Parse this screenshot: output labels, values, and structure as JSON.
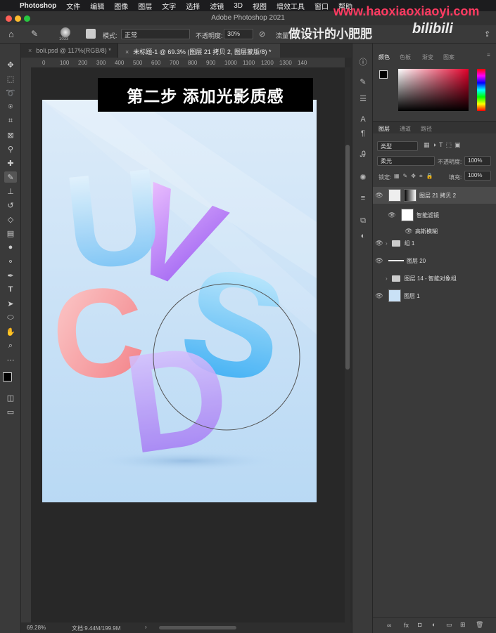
{
  "menubar": {
    "apple": "",
    "items": [
      "Photoshop",
      "文件",
      "编辑",
      "图像",
      "图层",
      "文字",
      "选择",
      "滤镜",
      "3D",
      "视图",
      "增效工具",
      "窗口",
      "帮助"
    ]
  },
  "window": {
    "title": "Adobe Photoshop 2021"
  },
  "options_bar": {
    "brush_size": "1033",
    "mode_label": "模式:",
    "mode_value": "正常",
    "opacity_label": "不透明度:",
    "opacity_value": "30%",
    "flow_label": "流量"
  },
  "doc_tabs": [
    {
      "label": "boli.psd @ 117%(RGB/8) *",
      "active": false
    },
    {
      "label": "未标题-1 @ 69.3% (图层 21 拷贝 2, 图层蒙版/8) *",
      "active": true
    }
  ],
  "ruler_top": [
    "0",
    "100",
    "200",
    "300",
    "400",
    "500",
    "600",
    "700",
    "800",
    "900",
    "1000",
    "1100",
    "1200",
    "1300",
    "140"
  ],
  "canvas": {
    "caption": "第二步 添加光影质感",
    "letters": [
      "U",
      "V",
      "C",
      "S",
      "D"
    ]
  },
  "status": {
    "zoom": "69.28%",
    "doc_info": "文档:9.44M/199.9M"
  },
  "color_panel": {
    "tabs": [
      "颜色",
      "色板",
      "渐变",
      "图案"
    ]
  },
  "layers_panel": {
    "tabs": [
      "图层",
      "通道",
      "路径"
    ],
    "filter_kind": "类型",
    "blend_mode": "柔光",
    "opacity_label": "不透明度:",
    "opacity_value": "100%",
    "lock_label": "锁定:",
    "fill_label": "填充:",
    "fill_value": "100%",
    "layers": [
      {
        "name": "图层 21 拷贝 2",
        "type": "smart",
        "selected": true
      },
      {
        "name": "智能滤镜",
        "type": "filter-group"
      },
      {
        "name": "高斯模糊",
        "type": "filter"
      },
      {
        "name": "组 1",
        "type": "group"
      },
      {
        "name": "图层 20",
        "type": "line"
      },
      {
        "name": "图层 14 - 智能对象组",
        "type": "group"
      },
      {
        "name": "图层 1",
        "type": "layer"
      }
    ]
  },
  "watermark": {
    "url": "www.haoxiaoxiaoyi.com",
    "channel": "做设计的小肥肥",
    "site": "bilibili"
  },
  "colors": {
    "menubar": "#1c1c1e",
    "panel": "#3a3a3a",
    "canvas_bg": "#282828",
    "accent_red": "#ff3b62"
  }
}
